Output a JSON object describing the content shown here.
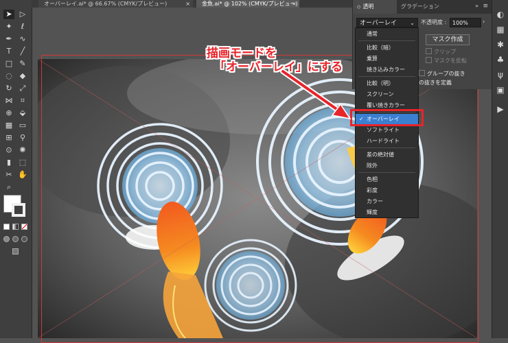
{
  "tabs": [
    {
      "label": "オーバーレイ.ai* @ 66.67% (CMYK/プレビュー)",
      "close": "×"
    },
    {
      "label": "金魚.ai* @ 102% (CMYK/プレビュー)",
      "close": "×"
    }
  ],
  "panel": {
    "tab_active": "透明",
    "tab_other": "グラデーション",
    "collapse": "»",
    "menu": "≡",
    "blend_mode": "オーバーレイ",
    "opacity_label": "不透明度 :",
    "opacity_value": "100%",
    "mask_button": "マスク作成",
    "clip": "クリップ",
    "invert_mask": "マスクを反転",
    "isolate": "グループの抜き",
    "knockout": "の抜きを定義"
  },
  "blend_menu": {
    "groups": [
      [
        "通常"
      ],
      [
        "比較（暗）",
        "乗算",
        "焼き込みカラー"
      ],
      [
        "比較（明）",
        "スクリーン",
        "覆い焼きカラー"
      ],
      [
        "オーバーレイ",
        "ソフトライト",
        "ハードライト"
      ],
      [
        "差の絶対値",
        "除外"
      ],
      [
        "色相",
        "彩度",
        "カラー",
        "輝度"
      ]
    ],
    "selected": "オーバーレイ",
    "check": "✓"
  },
  "annotation": {
    "line1": "描画モードを",
    "line2": "「オーバーレイ」にする",
    "color": "#e8242b"
  },
  "tools": [
    "selection-tool",
    "direct-selection-tool",
    "magic-wand-tool",
    "lasso-tool",
    "pen-tool",
    "curvature-tool",
    "type-tool",
    "line-tool",
    "rectangle-tool",
    "paintbrush-tool",
    "shaper-tool",
    "eraser-tool",
    "rotate-tool",
    "scale-tool",
    "width-tool",
    "free-transform-tool",
    "shape-builder-tool",
    "live-paint-tool",
    "perspective-grid-tool",
    "mesh-tool",
    "gradient-tool",
    "eyedropper-tool",
    "blend-tool",
    "symbol-sprayer-tool",
    "column-graph-tool",
    "artboard-tool",
    "slice-tool",
    "hand-tool",
    "zoom-tool"
  ]
}
